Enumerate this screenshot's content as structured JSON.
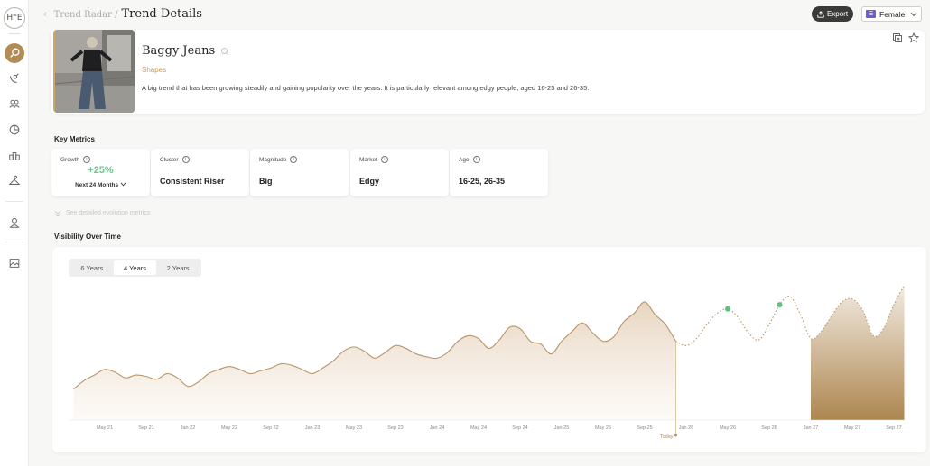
{
  "breadcrumb": {
    "back": "‹",
    "parent": "Trend Radar /",
    "current": "Trend Details"
  },
  "header": {
    "export_label": "Export",
    "gender_badge": "☰",
    "gender_value": "Female"
  },
  "trend": {
    "title": "Baggy Jeans",
    "category": "Shapes",
    "description": "A big trend that has been growing steadily and gaining popularity over the years. It is particularly relevant among edgy people, aged 16-25 and 26-35."
  },
  "key_metrics": {
    "title": "Key Metrics",
    "growth": {
      "label": "Growth",
      "value": "+25%",
      "period": "Next 24 Months"
    },
    "cluster": {
      "label": "Cluster",
      "value": "Consistent Riser"
    },
    "magnitude": {
      "label": "Magnitude",
      "value": "Big"
    },
    "market": {
      "label": "Market",
      "value": "Edgy"
    },
    "age": {
      "label": "Age",
      "value": "16-25, 26-35"
    }
  },
  "evolution_link": "See detailed evolution metrics",
  "visibility": {
    "title": "Visibility Over Time",
    "tabs": [
      "6 Years",
      "4 Years",
      "2 Years"
    ],
    "active_tab": "4 Years"
  },
  "colors": {
    "accent": "#b28b55",
    "line": "#b8956a",
    "growth": "#6cc28a",
    "forecast_marker": "#5fbf7f"
  },
  "chart_data": {
    "type": "area",
    "x_tick_labels": [
      "May 21",
      "Sep 21",
      "Jan 22",
      "May 22",
      "Sep 22",
      "Jan 23",
      "May 23",
      "Sep 23",
      "Jan 24",
      "May 24",
      "Sep 24",
      "Jan 25",
      "May 25",
      "Sep 25",
      "Jan 26",
      "May 26",
      "Sep 26",
      "Jan 27",
      "May 27",
      "Sep 27"
    ],
    "today_label": "Today",
    "today_at": "Dec 25",
    "y_range": [
      0,
      100
    ],
    "grid": false,
    "historical": {
      "x": [
        "Feb 21",
        "Mar 21",
        "Apr 21",
        "May 21",
        "Jun 21",
        "Jul 21",
        "Aug 21",
        "Sep 21",
        "Oct 21",
        "Nov 21",
        "Dec 21",
        "Jan 22",
        "Feb 22",
        "Mar 22",
        "Apr 22",
        "May 22",
        "Jun 22",
        "Jul 22",
        "Aug 22",
        "Sep 22",
        "Oct 22",
        "Nov 22",
        "Dec 22",
        "Jan 23",
        "Feb 23",
        "Mar 23",
        "Apr 23",
        "May 23",
        "Jun 23",
        "Jul 23",
        "Aug 23",
        "Sep 23",
        "Oct 23",
        "Nov 23",
        "Dec 23",
        "Jan 24",
        "Feb 24",
        "Mar 24",
        "Apr 24",
        "May 24",
        "Jun 24",
        "Jul 24",
        "Aug 24",
        "Sep 24",
        "Oct 24",
        "Nov 24",
        "Dec 24",
        "Jan 25",
        "Feb 25",
        "Mar 25",
        "Apr 25",
        "May 25",
        "Jun 25",
        "Jul 25",
        "Aug 25",
        "Sep 25",
        "Oct 25",
        "Nov 25",
        "Dec 25"
      ],
      "values": [
        22,
        28,
        32,
        36,
        34,
        30,
        32,
        31,
        29,
        33,
        30,
        24,
        27,
        33,
        36,
        38,
        36,
        33,
        35,
        37,
        40,
        39,
        36,
        33,
        37,
        42,
        49,
        52,
        49,
        44,
        48,
        53,
        51,
        47,
        45,
        44,
        48,
        56,
        60,
        58,
        51,
        57,
        66,
        65,
        56,
        54,
        47,
        56,
        63,
        69,
        62,
        56,
        59,
        70,
        76,
        84,
        75,
        68,
        56
      ]
    },
    "forecast": {
      "x": [
        "Dec 25",
        "Jan 26",
        "Feb 26",
        "Mar 26",
        "Apr 26",
        "May 26",
        "Jun 26",
        "Jul 26",
        "Aug 26",
        "Sep 26",
        "Oct 26",
        "Nov 26",
        "Dec 26",
        "Jan 27",
        "Feb 27",
        "Mar 27",
        "Apr 27",
        "May 27",
        "Jun 27",
        "Jul 27",
        "Aug 27",
        "Sep 27",
        "Oct 27"
      ],
      "values": [
        56,
        53,
        58,
        68,
        76,
        79,
        73,
        62,
        57,
        68,
        82,
        88,
        75,
        58,
        63,
        74,
        84,
        86,
        78,
        60,
        65,
        82,
        96
      ],
      "markers": [
        {
          "x": "May 26",
          "value": 79
        },
        {
          "x": "Oct 26",
          "value": 82
        }
      ],
      "highlight_range": [
        "Jan 27",
        "Oct 27"
      ]
    }
  }
}
